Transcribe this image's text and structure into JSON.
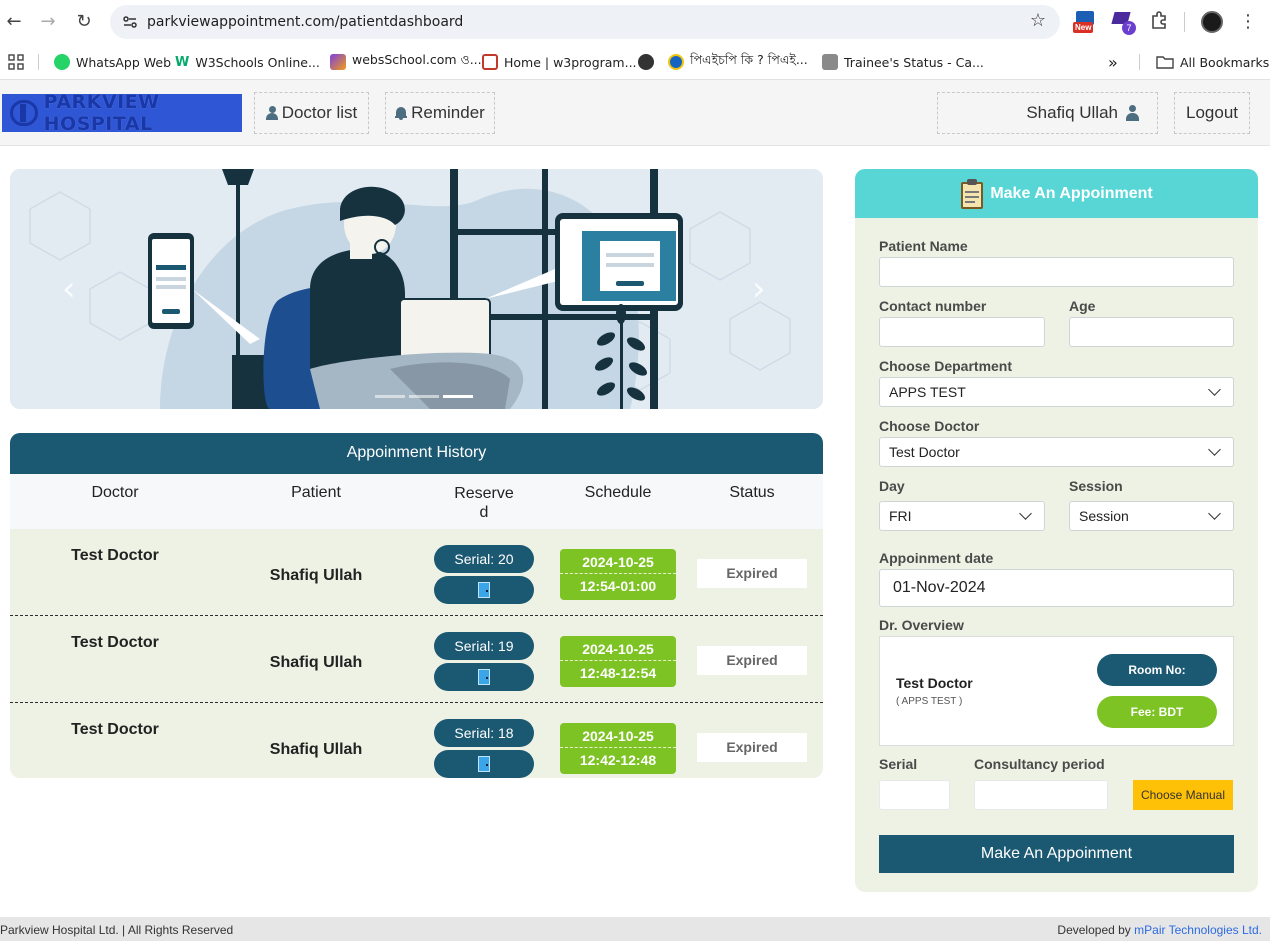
{
  "browser": {
    "url": "parkviewappointment.com/patientdashboard",
    "new_badge": "New",
    "ext_count": "7",
    "bookmarks": [
      {
        "label": "WhatsApp Web",
        "icon": "whatsapp-icon",
        "color": "#25d366"
      },
      {
        "label": "W3Schools Online...",
        "icon": "w3schools-icon",
        "color": "#04aa6d"
      },
      {
        "label": "websSchool.com ও...",
        "icon": "websschool-icon",
        "color": "#7b3fe4"
      },
      {
        "label": "Home | w3program...",
        "icon": "w3program-icon",
        "color": "#c0392b"
      },
      {
        "label": "",
        "icon": "globe-icon",
        "color": "#333333"
      },
      {
        "label": "পিএইচপি কি ? পিএই...",
        "icon": "php-icon",
        "color": "#1565c0"
      },
      {
        "label": "Trainee's Status - Ca...",
        "icon": "trainee-icon",
        "color": "#8a8a8a"
      }
    ],
    "all_bookmarks": "All Bookmarks"
  },
  "header": {
    "logo_text": "PARKVIEW HOSPITAL",
    "doctor_list": "Doctor list",
    "reminder": "Reminder",
    "user_name": "Shafiq Ullah",
    "logout": "Logout"
  },
  "carousel": {
    "prev": "‹",
    "next": "›",
    "slides": 3,
    "active_slide": 3
  },
  "history": {
    "title": "Appoinment History",
    "columns": [
      "Doctor",
      "Patient",
      "Reserve d",
      "Schedule",
      "Status"
    ],
    "rows": [
      {
        "doctor": "Test Doctor",
        "patient": "Shafiq Ullah",
        "serial": "Serial: 20",
        "date": "2024-10-25",
        "time": "12:54-01:00",
        "status": "Expired"
      },
      {
        "doctor": "Test Doctor",
        "patient": "Shafiq Ullah",
        "serial": "Serial: 19",
        "date": "2024-10-25",
        "time": "12:48-12:54",
        "status": "Expired"
      },
      {
        "doctor": "Test Doctor",
        "patient": "Shafiq Ullah",
        "serial": "Serial: 18",
        "date": "2024-10-25",
        "time": "12:42-12:48",
        "status": "Expired"
      }
    ]
  },
  "form": {
    "title": "Make An Appoinment",
    "patient_name_label": "Patient Name",
    "patient_name_value": "",
    "contact_label": "Contact number",
    "contact_value": "",
    "age_label": "Age",
    "age_value": "",
    "department_label": "Choose Department",
    "department_value": "APPS TEST",
    "doctor_label": "Choose Doctor",
    "doctor_value": "Test Doctor",
    "day_label": "Day",
    "day_value": "FRI",
    "session_label": "Session",
    "session_value": "Session",
    "date_label": "Appoinment date",
    "date_value": "01-Nov-2024",
    "overview_label": "Dr. Overview",
    "overview_doctor": "Test Doctor",
    "overview_dept": "( APPS TEST )",
    "room_label": "Room No:",
    "fee_label": "Fee: BDT",
    "serial_label": "Serial",
    "serial_value": "",
    "period_label": "Consultancy period",
    "period_value": "",
    "manual_button": "Choose Manual",
    "submit_button": "Make An Appoinment"
  },
  "footer": {
    "copyright": "Parkview Hospital Ltd. | All Rights Reserved",
    "developed_by": "Developed by ",
    "company": "mPair Technologies Ltd."
  },
  "colors": {
    "primary_dark": "#1b5872",
    "accent_teal": "#58d6d6",
    "success_green": "#7cc323",
    "warning_yellow": "#ffc107",
    "logo_blue": "#2f56d4",
    "panel_bg": "#eef2e4"
  }
}
